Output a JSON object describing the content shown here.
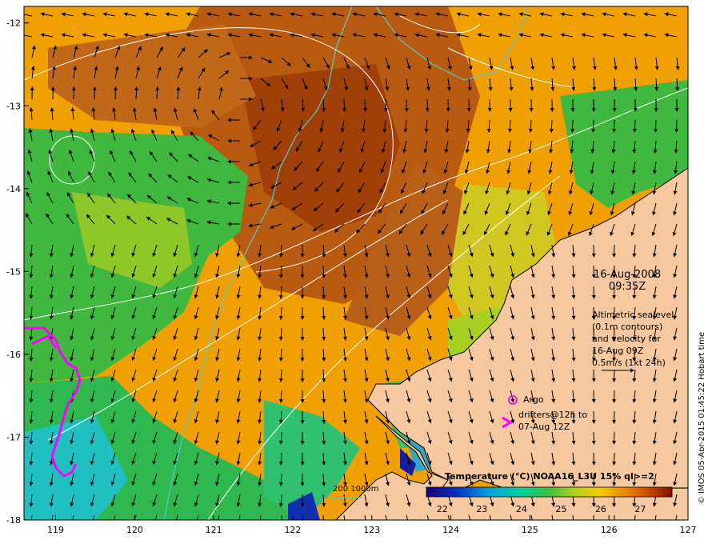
{
  "map": {
    "lon_ticks": [
      "119",
      "120",
      "121",
      "122",
      "123",
      "124",
      "125",
      "126",
      "127"
    ],
    "lat_ticks": [
      "-12",
      "-13",
      "-14",
      "-15",
      "-16",
      "-17",
      "-18"
    ],
    "extent": {
      "lon": [
        118.6,
        127.0
      ],
      "lat": [
        -18.0,
        -11.8
      ]
    }
  },
  "date": {
    "line1": "16-Aug-2008",
    "line2": "09:35Z"
  },
  "altimetry_note": {
    "line1": "Altimetric sealevel",
    "line2": "(0.1m contours)",
    "line3": "and velocity for",
    "line4": "16-Aug 09Z",
    "line5": "0.5m/s (1kt 24h)"
  },
  "legend": {
    "argo": "Argo",
    "drifters_line1": "drifters@12h to",
    "drifters_line2": "07-Aug 12Z",
    "depth": "200  1000m"
  },
  "colorbar": {
    "title": "Temperature (°C) NOAA16_L3U 15% ql>=2",
    "ticks": [
      "22",
      "23",
      "24",
      "25",
      "26",
      "27"
    ],
    "range": [
      21.6,
      27.8
    ]
  },
  "credit": "© IMOS 05-Apr-2015 01:45:22 Hobart time",
  "colors": {
    "land": "#f5c8a0",
    "argo": "#e020e0",
    "drifter": "#ff00ff",
    "contour_200": "#5cc8c8",
    "sealevel_contour": "#ffffff"
  }
}
